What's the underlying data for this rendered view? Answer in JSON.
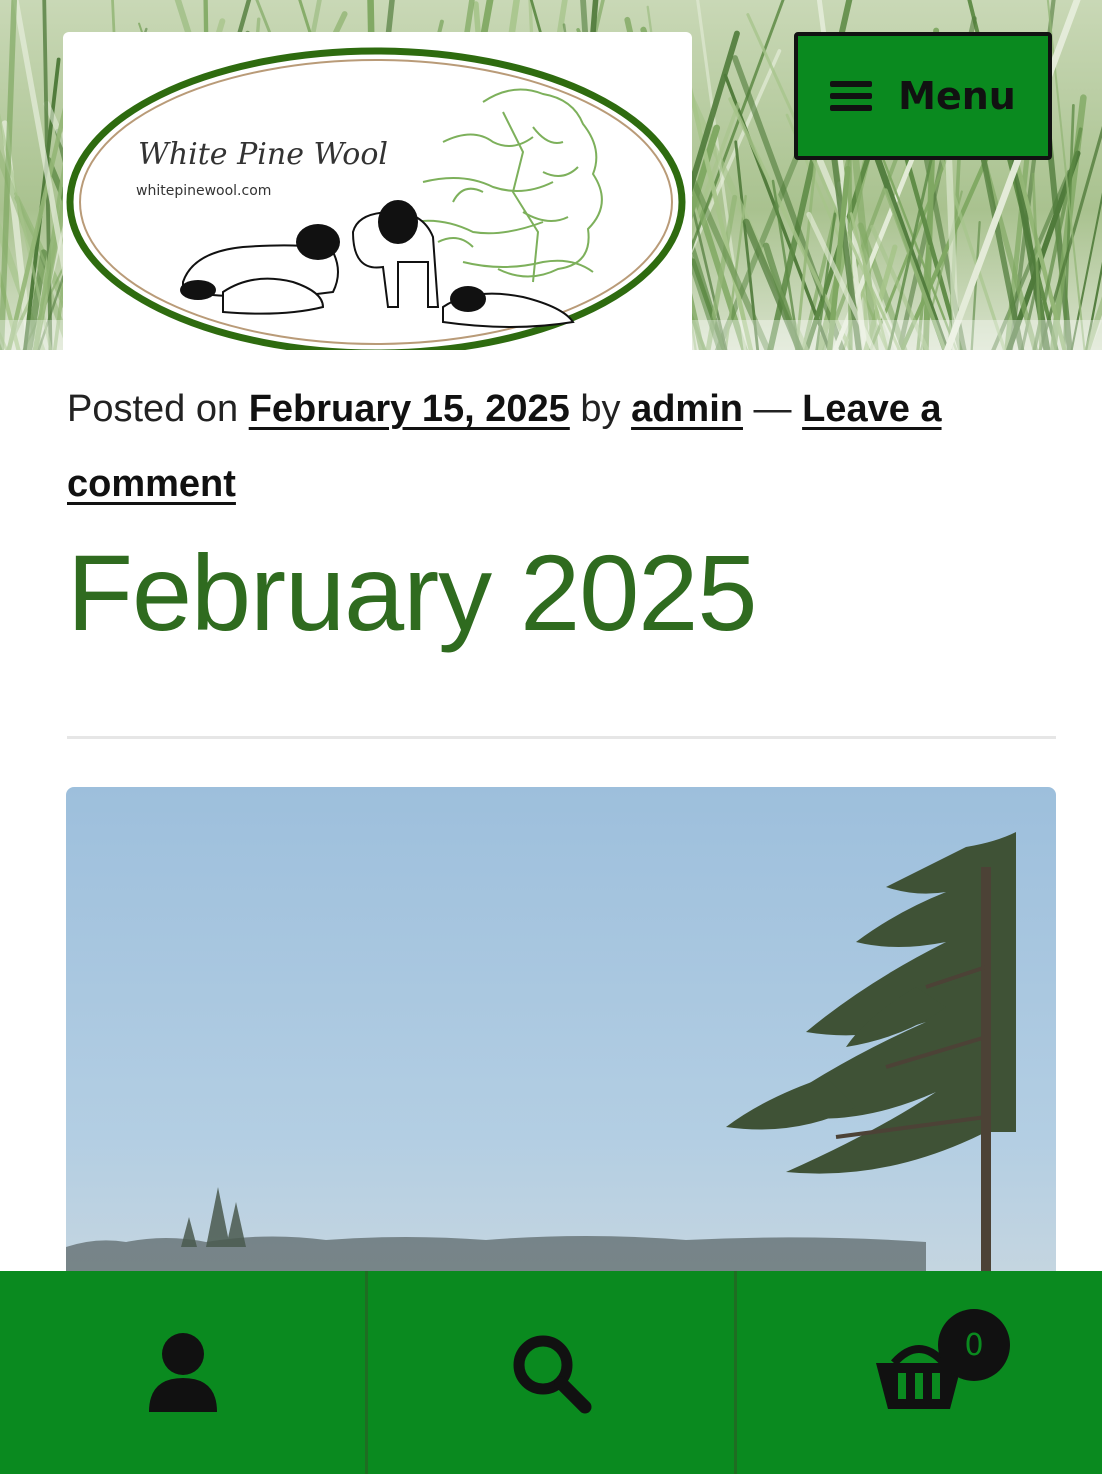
{
  "header": {
    "logo": {
      "name": "White Pine Wool",
      "url_text": "whitepinewool.com"
    },
    "menu_label": "Menu"
  },
  "post_meta": {
    "prefix": "Posted on",
    "date": "February 15, 2025",
    "by": "by",
    "author": "admin",
    "separator": "—",
    "comment_link": "Leave a comment"
  },
  "page_title": "February 2025",
  "bottom_bar": {
    "items": [
      {
        "icon": "account-icon"
      },
      {
        "icon": "search-icon"
      },
      {
        "icon": "cart-icon",
        "count": "0"
      }
    ]
  },
  "colors": {
    "brand_green": "#0a8a1f",
    "title_green": "#2f6b1f",
    "logo_green": "#2e6b0f"
  }
}
